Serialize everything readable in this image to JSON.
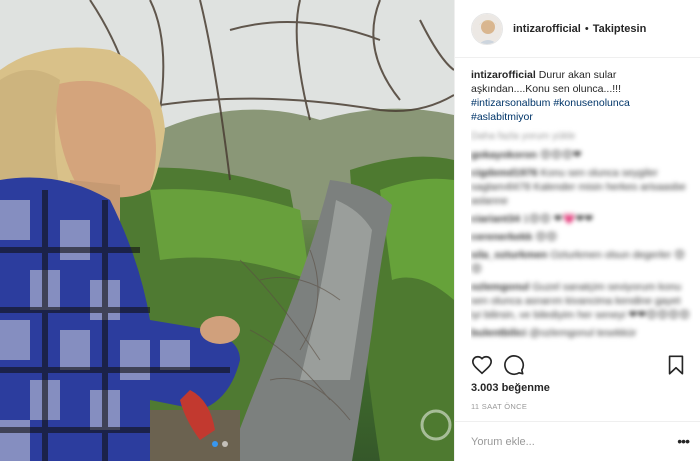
{
  "post": {
    "username": "intizarofficial",
    "follow_status": "Takiptesin",
    "separator": "•",
    "avatar_label": "intizar",
    "caption_text": "Durur akan sular aşkından....Konu sen olunca...!!!",
    "hashtags": [
      "#intizarsonalbum",
      "#konusenolunca",
      "#aslabitmiyor"
    ],
    "load_more": "Daha fazla yorum yükle",
    "comments": [
      {
        "user": "gokayokoron",
        "text": "😍😍😍❤"
      },
      {
        "user": "cigdemd1976",
        "text": "Konu sen olunca seygiler saglam4l478 Kalender misin herkes arisaasbe aslanne"
      },
      {
        "user": "ciariant34",
        "text": "1😍😍 ❤💗❤❤"
      },
      {
        "user": "cerenerkekk",
        "text": "😍😍"
      },
      {
        "user": "sila_ozturkmen",
        "text": "Ozturkmen olsun degerler 😍😍"
      },
      {
        "user": "ozlemgonul",
        "text": "Guzel sanatçim seviyorum konu sen olunca asnarım kivancima kendine gayet iyi bilirsin, ve bilediyim her seneyi ❤❤😍😍😍😍"
      },
      {
        "user": "bulentbilici",
        "text": "@ozlemgonul tesekkür"
      }
    ],
    "likes": "3.003 beğenme",
    "time_ago": "11 SAAT ÖNCE",
    "comment_placeholder": "Yorum ekle...",
    "more_label": "•••"
  },
  "icons": {
    "like": "heart-icon",
    "comment": "comment-icon",
    "save": "bookmark-icon",
    "more": "more-options-icon"
  },
  "colors": {
    "text": "#262626",
    "muted": "#999999",
    "hashtag": "#003569",
    "border": "#efefef"
  }
}
